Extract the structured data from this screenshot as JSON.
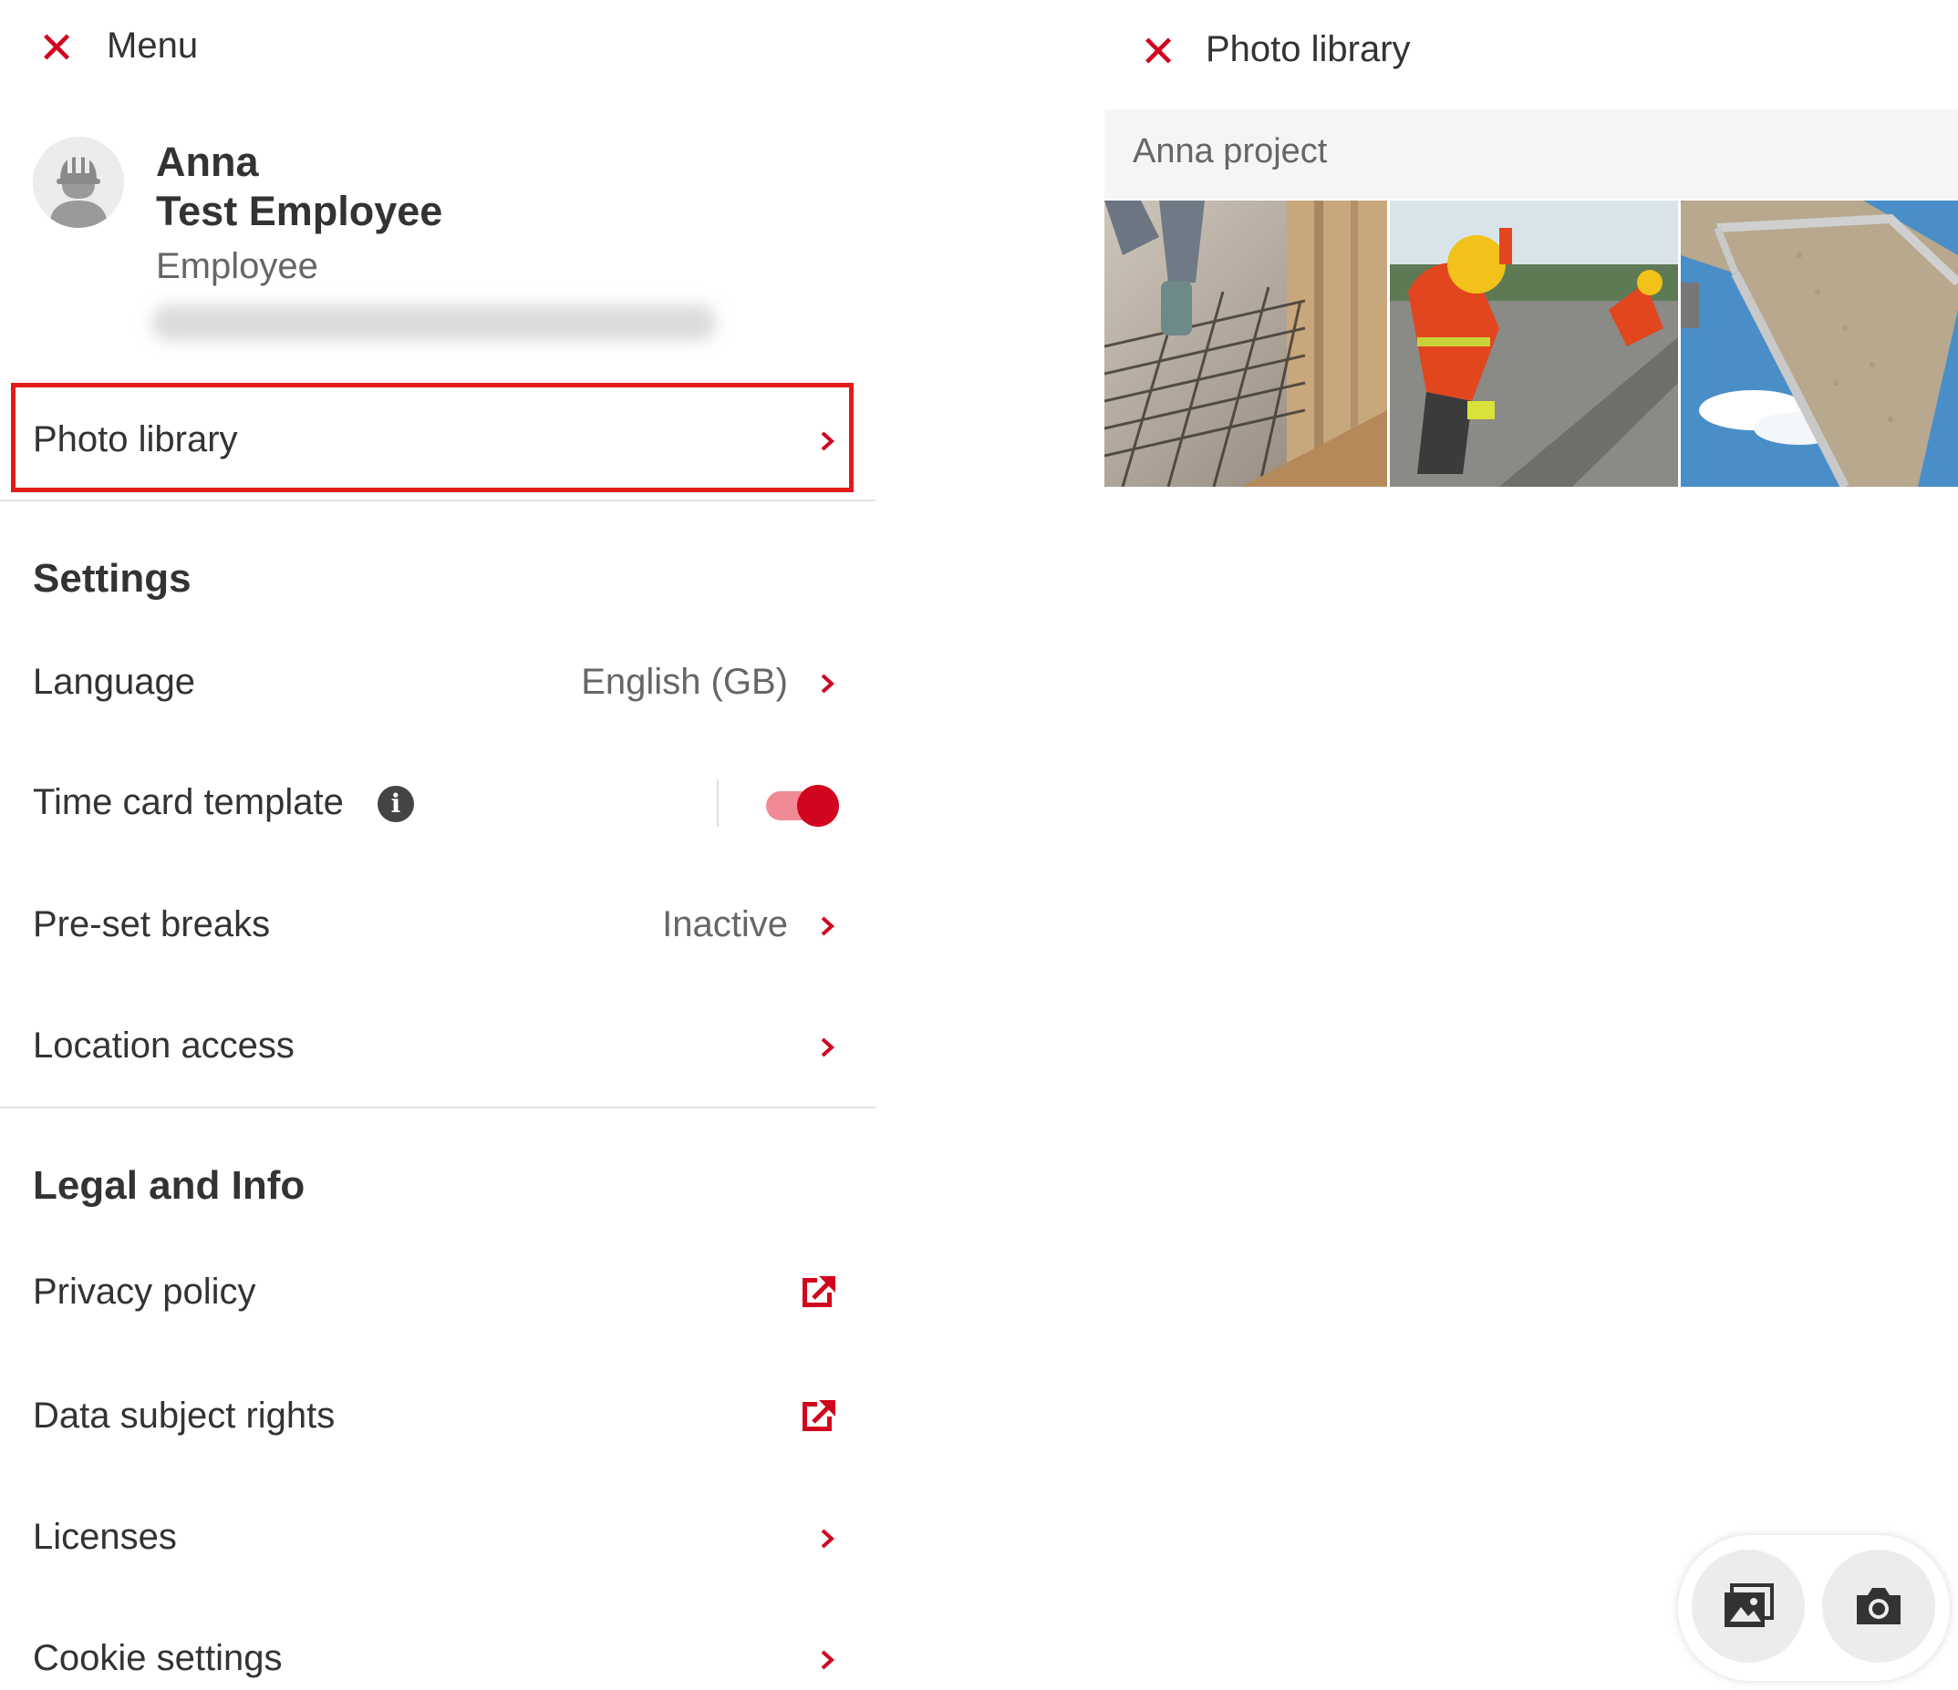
{
  "left_panel": {
    "header_title": "Menu",
    "profile": {
      "first_name": "Anna",
      "last_name": "Test Employee",
      "role": "Employee"
    },
    "photo_library_label": "Photo library",
    "settings": {
      "heading": "Settings",
      "language_label": "Language",
      "language_value": "English (GB)",
      "time_card_label": "Time card template",
      "time_card_enabled": true,
      "preset_breaks_label": "Pre-set breaks",
      "preset_breaks_value": "Inactive",
      "location_label": "Location access"
    },
    "legal": {
      "heading": "Legal and Info",
      "privacy_label": "Privacy policy",
      "dsr_label": "Data subject rights",
      "licenses_label": "Licenses",
      "cookie_label": "Cookie settings"
    }
  },
  "right_panel": {
    "header_title": "Photo library",
    "project_name": "Anna project",
    "photos": [
      "construction-photo-1",
      "construction-photo-2",
      "construction-photo-3"
    ],
    "actions": [
      "gallery-icon",
      "camera-icon"
    ]
  },
  "colors": {
    "accent": "#d2051e",
    "toggle_track": "#f08a95"
  }
}
